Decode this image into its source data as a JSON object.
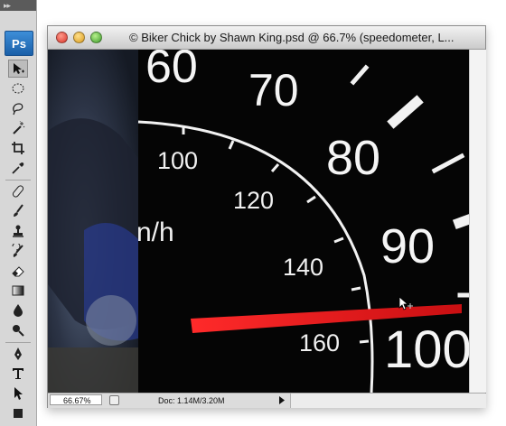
{
  "app": {
    "logo": "Ps"
  },
  "tools_panel": {
    "grip": "▸▸",
    "tools": [
      {
        "name": "move-tool-icon",
        "active": true
      },
      {
        "name": "marquee-tool-icon"
      },
      {
        "name": "lasso-tool-icon"
      },
      {
        "name": "magic-wand-tool-icon"
      },
      {
        "name": "crop-tool-icon"
      },
      {
        "name": "eyedropper-tool-icon"
      },
      {
        "name": "healing-brush-tool-icon"
      },
      {
        "name": "brush-tool-icon"
      },
      {
        "name": "clone-stamp-tool-icon"
      },
      {
        "name": "history-brush-tool-icon"
      },
      {
        "name": "eraser-tool-icon"
      },
      {
        "name": "gradient-tool-icon"
      },
      {
        "name": "blur-tool-icon"
      },
      {
        "name": "dodge-tool-icon"
      },
      {
        "name": "pen-tool-icon"
      },
      {
        "name": "type-tool-icon"
      },
      {
        "name": "path-selection-tool-icon"
      }
    ]
  },
  "document": {
    "title": "© Biker Chick by Shawn King.psd @ 66.7% (speedometer, L...",
    "canvas": {
      "speedometer_outer_numbers": [
        "60",
        "70",
        "80",
        "90",
        "100"
      ],
      "speedometer_inner_numbers": [
        "100",
        "120",
        "140",
        "160"
      ],
      "unit_label": "n/h",
      "needle_color": "#e5141a"
    },
    "status": {
      "zoom": "66.67%",
      "doc_info": "Doc: 1.14M/3.20M"
    }
  }
}
